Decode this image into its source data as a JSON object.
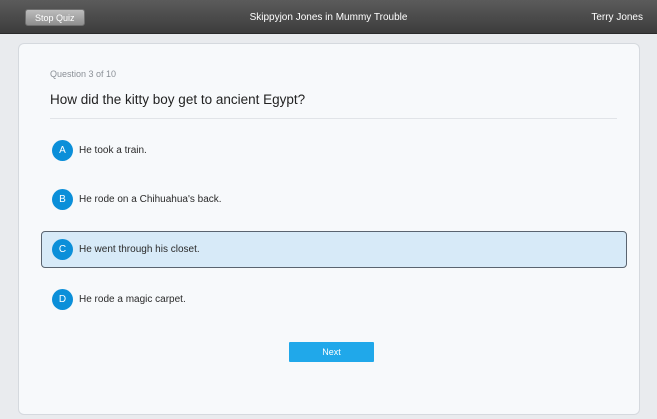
{
  "topbar": {
    "stop_label": "Stop Quiz",
    "title": "Skippyjon Jones in Mummy Trouble",
    "user": "Terry Jones"
  },
  "quiz": {
    "progress": "Question 3 of 10",
    "question": "How did the kitty boy get to ancient Egypt?",
    "answers": [
      {
        "letter": "A",
        "text": "He took a train.",
        "selected": false
      },
      {
        "letter": "B",
        "text": "He rode on a Chihuahua's back.",
        "selected": false
      },
      {
        "letter": "C",
        "text": "He went through his closet.",
        "selected": true
      },
      {
        "letter": "D",
        "text": "He rode a magic carpet.",
        "selected": false
      }
    ],
    "next_label": "Next"
  },
  "colors": {
    "accent": "#0b8fd9",
    "next_button": "#20a8ea",
    "selected_bg": "#d7eaf8",
    "topbar": "#4a4a4a"
  }
}
